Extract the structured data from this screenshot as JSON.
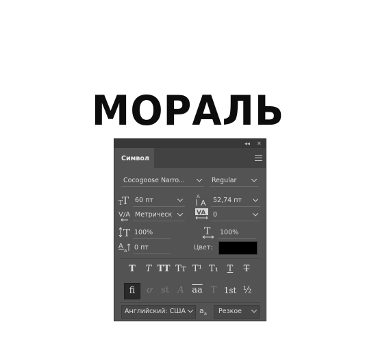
{
  "canvas": {
    "heading": "МОРАЛЬ"
  },
  "panel": {
    "titlebar": {
      "collapse_glyph": "◂◂",
      "close_glyph": "✕"
    },
    "tab": "Символ",
    "font_family": "Cocogoose Narro...",
    "font_style": "Regular",
    "font_size": "60 пт",
    "leading": "52,74 пт",
    "kerning": "Метрическ",
    "tracking": "0",
    "vertical_scale": "100%",
    "horizontal_scale": "100%",
    "baseline_shift": "0 пт",
    "color_label": "Цвет:",
    "color_value": "#000000",
    "language": "Английский: США",
    "antialias_icon_text": "a",
    "antialias_icon_sub": "a",
    "antialias": "Резкое",
    "format_buttons": [
      {
        "name": "faux-bold-button",
        "glyph": "T"
      },
      {
        "name": "faux-italic-button",
        "glyph": "T"
      },
      {
        "name": "all-caps-button",
        "glyph": "TT"
      },
      {
        "name": "small-caps-button",
        "glyph": "Tт"
      },
      {
        "name": "superscript-button",
        "glyph": "T¹"
      },
      {
        "name": "subscript-button",
        "glyph": "T₁"
      },
      {
        "name": "underline-button",
        "glyph": "T"
      },
      {
        "name": "strikethrough-button",
        "glyph": "T"
      }
    ],
    "opentype_buttons": [
      {
        "name": "standard-ligatures-button",
        "glyph": "fi"
      },
      {
        "name": "contextual-alternates-button",
        "glyph": "ơ"
      },
      {
        "name": "discretionary-ligatures-button",
        "glyph": "st"
      },
      {
        "name": "swash-button",
        "glyph": "A"
      },
      {
        "name": "stylistic-alternates-button",
        "glyph": "aa"
      },
      {
        "name": "titling-alternates-button",
        "glyph": "T"
      },
      {
        "name": "ordinals-button",
        "glyph": "1st"
      },
      {
        "name": "fractions-button",
        "glyph": "½"
      }
    ]
  }
}
